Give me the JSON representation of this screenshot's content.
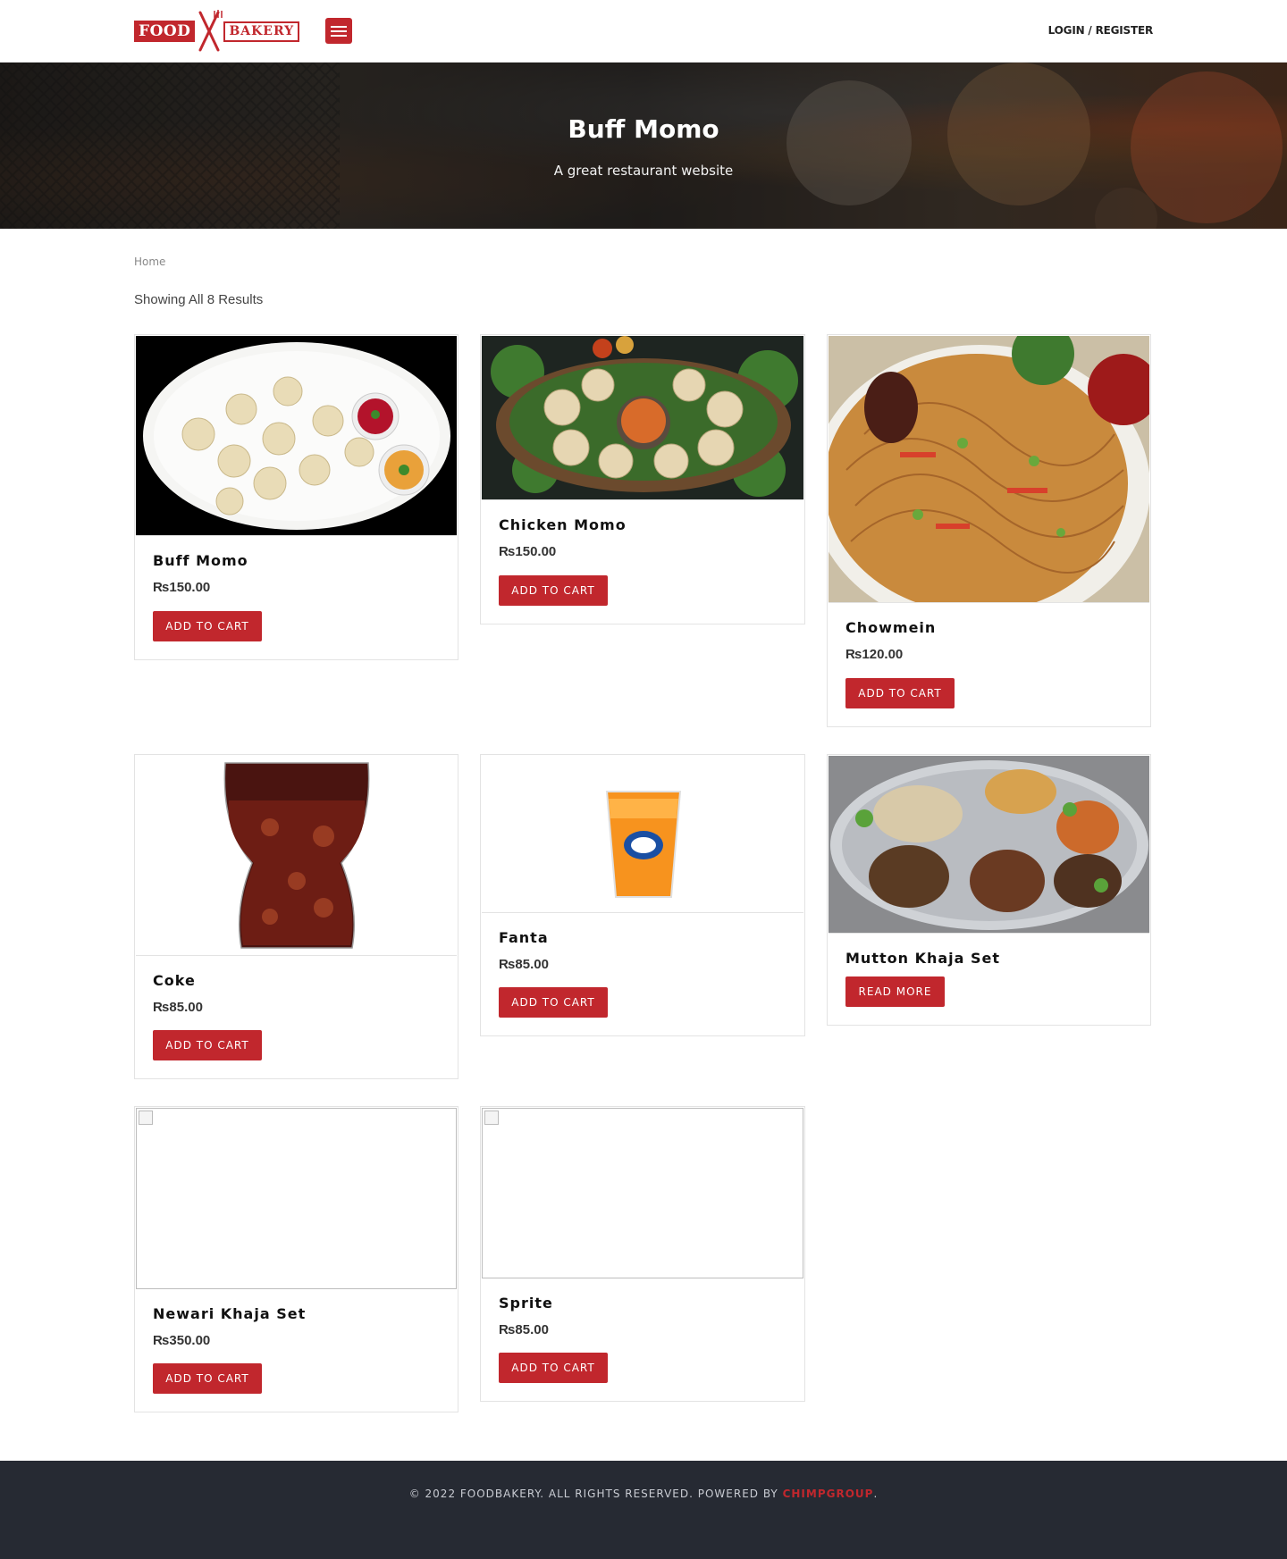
{
  "header": {
    "logo_left": "FOOD",
    "logo_right": "BAKERY",
    "login_label": "LOGIN / REGISTER"
  },
  "hero": {
    "title": "Buff Momo",
    "subtitle": "A great restaurant website"
  },
  "breadcrumb": {
    "home": "Home"
  },
  "results_text": "Showing All 8 Results",
  "products": [
    {
      "name": "Buff Momo",
      "currency": "₨",
      "price": "150.00",
      "button": "ADD TO CART"
    },
    {
      "name": "Chicken Momo",
      "currency": "₨",
      "price": "150.00",
      "button": "ADD TO CART"
    },
    {
      "name": "Chowmein",
      "currency": "₨",
      "price": "120.00",
      "button": "ADD TO CART"
    },
    {
      "name": "Coke",
      "currency": "₨",
      "price": "85.00",
      "button": "ADD TO CART"
    },
    {
      "name": "Fanta",
      "currency": "₨",
      "price": "85.00",
      "button": "ADD TO CART"
    },
    {
      "name": "Mutton Khaja Set",
      "button": "READ MORE"
    },
    {
      "name": "Newari Khaja Set",
      "currency": "₨",
      "price": "350.00",
      "button": "ADD TO CART"
    },
    {
      "name": "Sprite",
      "currency": "₨",
      "price": "85.00",
      "button": "ADD TO CART"
    }
  ],
  "footer": {
    "text": "© 2022 FOODBAKERY. ALL RIGHTS RESERVED. POWERED BY ",
    "link": "CHIMPGROUP",
    "end": "."
  },
  "colors": {
    "brand": "#c1272d",
    "footer_bg": "#262a33"
  }
}
